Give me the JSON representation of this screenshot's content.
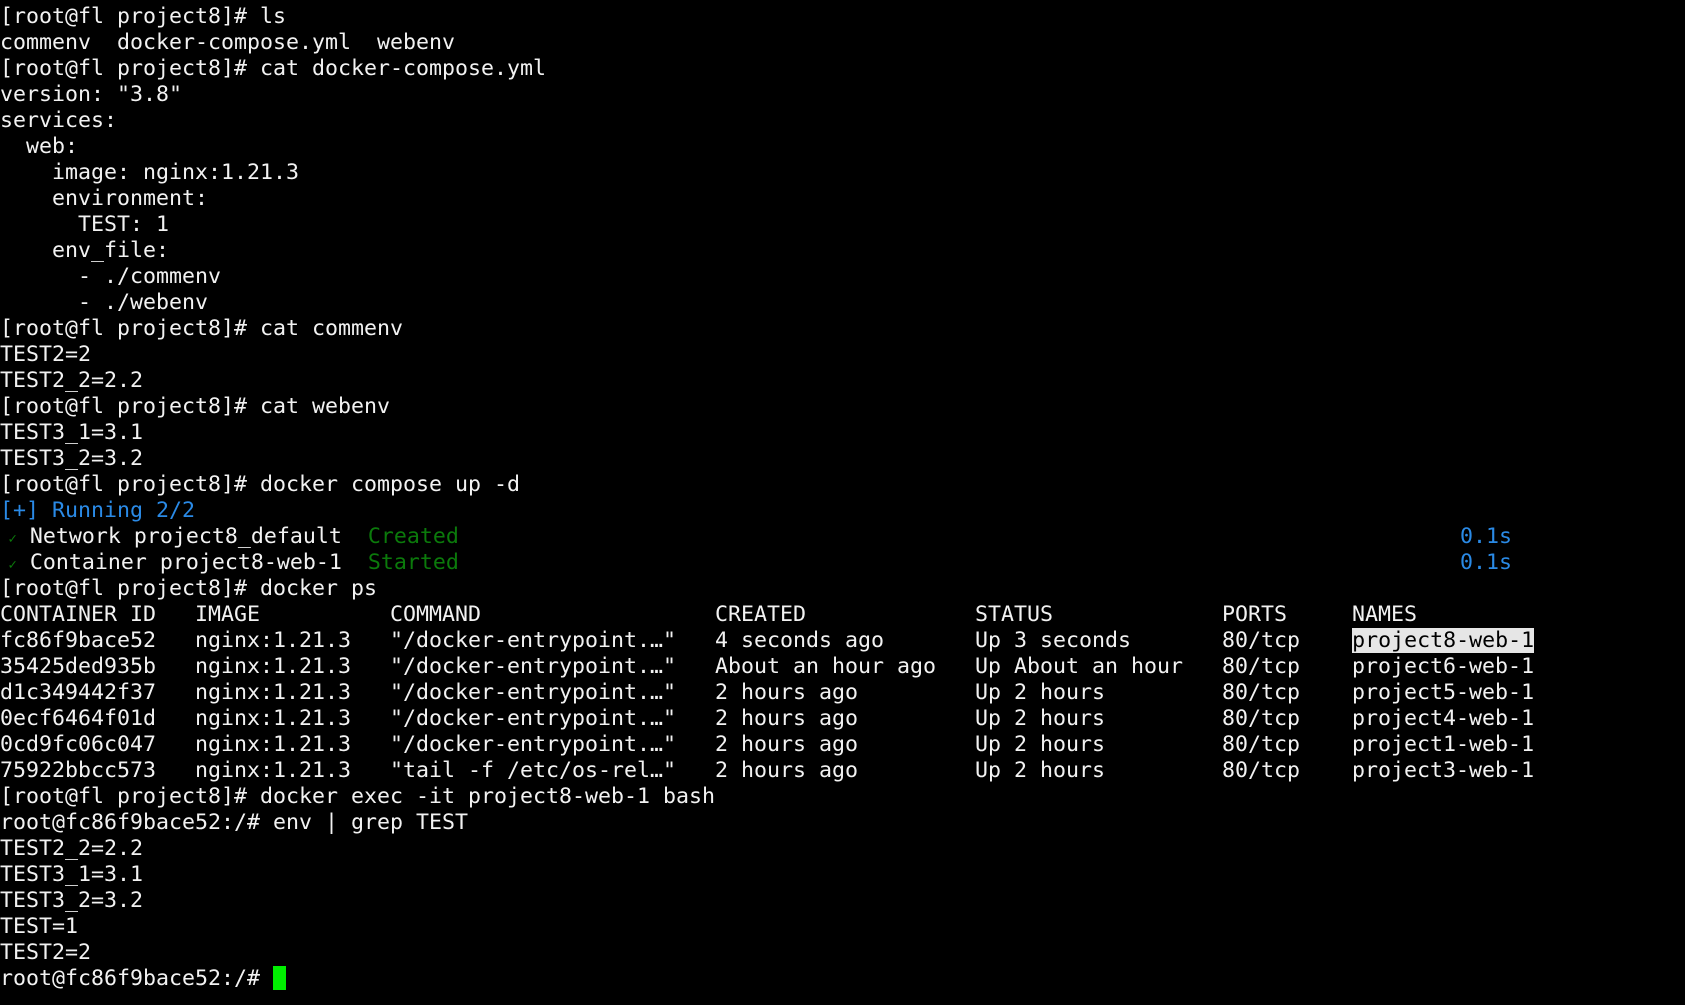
{
  "colors": {
    "foreground": "#f2f2f2",
    "background": "#000000",
    "blue": "#2a8ae6",
    "green": "#0b7a0b",
    "cursor": "#00ee00"
  },
  "lines": [
    [
      {
        "t": "[root@fl project8]# ls"
      }
    ],
    [
      {
        "t": "commenv  docker-compose.yml  webenv"
      }
    ],
    [
      {
        "t": "[root@fl project8]# cat docker-compose.yml"
      }
    ],
    [
      {
        "t": "version: \"3.8\""
      }
    ],
    [
      {
        "t": "services:"
      }
    ],
    [
      {
        "t": "  web:"
      }
    ],
    [
      {
        "t": "    image: nginx:1.21.3"
      }
    ],
    [
      {
        "t": "    environment:"
      }
    ],
    [
      {
        "t": "      TEST: 1"
      }
    ],
    [
      {
        "t": "    env_file:"
      }
    ],
    [
      {
        "t": "      - ./commenv"
      }
    ],
    [
      {
        "t": "      - ./webenv"
      }
    ],
    [
      {
        "t": "[root@fl project8]# cat commenv"
      }
    ],
    [
      {
        "t": "TEST2=2"
      }
    ],
    [
      {
        "t": "TEST2_2=2.2"
      }
    ],
    [
      {
        "t": "[root@fl project8]# cat webenv"
      }
    ],
    [
      {
        "t": "TEST3_1=3.1"
      }
    ],
    [
      {
        "t": "TEST3_2=3.2"
      }
    ],
    [
      {
        "t": "[root@fl project8]# docker compose up -d"
      }
    ],
    [
      {
        "t": "[+] Running 2/2",
        "c": "blue"
      }
    ],
    [
      {
        "t": " ✓",
        "c": "green",
        "small": true
      },
      {
        "t": " Network project8_default  "
      },
      {
        "t": "Created",
        "c": "green"
      },
      {
        "t": "                                                                             "
      },
      {
        "t": "0.1s",
        "c": "blue"
      }
    ],
    [
      {
        "t": " ✓",
        "c": "green",
        "small": true
      },
      {
        "t": " Container project8-web-1  "
      },
      {
        "t": "Started",
        "c": "green"
      },
      {
        "t": "                                                                             "
      },
      {
        "t": "0.1s",
        "c": "blue"
      }
    ],
    [
      {
        "t": "[root@fl project8]# docker ps"
      }
    ],
    [
      {
        "t": "CONTAINER ID   IMAGE          COMMAND                  CREATED             STATUS             PORTS     NAMES"
      }
    ],
    [
      {
        "t": "fc86f9bace52   nginx:1.21.3   \"/docker-entrypoint.…\"   4 seconds ago       Up 3 seconds       80/tcp    "
      },
      {
        "t": "project8-web-1",
        "hl": true
      }
    ],
    [
      {
        "t": "35425ded935b   nginx:1.21.3   \"/docker-entrypoint.…\"   About an hour ago   Up About an hour   80/tcp    project6-web-1"
      }
    ],
    [
      {
        "t": "d1c349442f37   nginx:1.21.3   \"/docker-entrypoint.…\"   2 hours ago         Up 2 hours         80/tcp    project5-web-1"
      }
    ],
    [
      {
        "t": "0ecf6464f01d   nginx:1.21.3   \"/docker-entrypoint.…\"   2 hours ago         Up 2 hours         80/tcp    project4-web-1"
      }
    ],
    [
      {
        "t": "0cd9fc06c047   nginx:1.21.3   \"/docker-entrypoint.…\"   2 hours ago         Up 2 hours         80/tcp    project1-web-1"
      }
    ],
    [
      {
        "t": "75922bbcc573   nginx:1.21.3   \"tail -f /etc/os-rel…\"   2 hours ago         Up 2 hours         80/tcp    project3-web-1"
      }
    ],
    [
      {
        "t": "[root@fl project8]# docker exec -it project8-web-1 bash"
      }
    ],
    [
      {
        "t": "root@fc86f9bace52:/# env | grep TEST"
      }
    ],
    [
      {
        "t": "TEST2_2=2.2"
      }
    ],
    [
      {
        "t": "TEST3_1=3.1"
      }
    ],
    [
      {
        "t": "TEST3_2=3.2"
      }
    ],
    [
      {
        "t": "TEST=1"
      }
    ],
    [
      {
        "t": "TEST2=2"
      }
    ],
    [
      {
        "t": "root@fc86f9bace52:/# "
      },
      {
        "cursor": true
      }
    ]
  ]
}
